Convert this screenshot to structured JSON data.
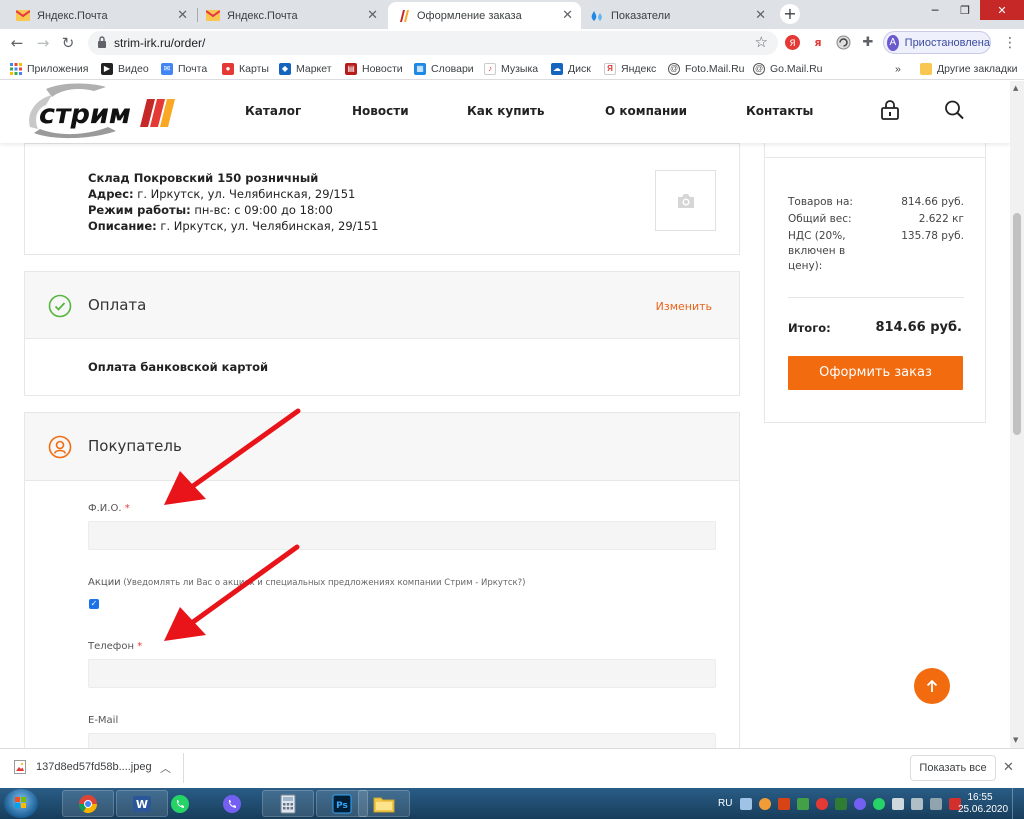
{
  "browser": {
    "tabs": [
      {
        "title": "Яндекс.Почта",
        "active": false
      },
      {
        "title": "Яндекс.Почта",
        "active": false
      },
      {
        "title": "Оформление заказа",
        "active": true
      },
      {
        "title": "Показатели",
        "active": false
      }
    ],
    "url": "strim-irk.ru/order/",
    "profile_initial": "A",
    "profile_status": "Приостановлена",
    "ext_labels": [
      "Я",
      "я"
    ],
    "bookmarks": [
      "Приложения",
      "Видео",
      "Почта",
      "Карты",
      "Маркет",
      "Новости",
      "Словари",
      "Музыка",
      "Диск",
      "Яндекс",
      "Foto.Mail.Ru",
      "Go.Mail.Ru"
    ],
    "bookmarks_more": "»",
    "other_bookmarks": "Другие закладки"
  },
  "site": {
    "logo_text": "стрим",
    "nav": [
      "Каталог",
      "Новости",
      "Как купить",
      "О компании",
      "Контакты"
    ]
  },
  "warehouse": {
    "name": "Склад Покровский 150 розничный",
    "address_label": "Адрес:",
    "address_value": " г. Иркутск, ул. Челябинская, 29/151",
    "hours_label": "Режим работы:",
    "hours_value": " пн-вс: с 09:00 до 18:00",
    "desc_label": "Описание:",
    "desc_value": " г. Иркутск, ул. Челябинская, 29/151"
  },
  "payment": {
    "title": "Оплата",
    "change": "Изменить",
    "method": "Оплата банковской картой"
  },
  "buyer": {
    "title": "Покупатель",
    "fio_label": "Ф.И.О.",
    "required_mark": "*",
    "promo_label": "Акции",
    "promo_hint": " (Уведомлять ли Вас о акциях и специальных предложениях компании Стрим - Иркутск?)",
    "promo_checked": true,
    "checkmark": "✓",
    "phone_label": "Телефон",
    "email_label": "E-Mail"
  },
  "summary": {
    "rows": [
      {
        "k": "Товаров на:",
        "v": "814.66 руб."
      },
      {
        "k": "Общий вес:",
        "v": "2.622 кг"
      },
      {
        "k": "НДС (20%, включен в цену):",
        "v": "135.78 руб."
      }
    ],
    "total_label": "Итого:",
    "total_value": "814.66 руб.",
    "order_button": "Оформить заказ"
  },
  "downloads": {
    "file": "137d8ed57fd58b....jpeg",
    "show_all": "Показать все"
  },
  "taskbar": {
    "lang": "RU",
    "time": "16:55",
    "date": "25.06.2020"
  },
  "colors": {
    "accent": "#f26b0f",
    "link": "#e8641b",
    "arrow": "#e8141a",
    "success": "#55b63b"
  }
}
